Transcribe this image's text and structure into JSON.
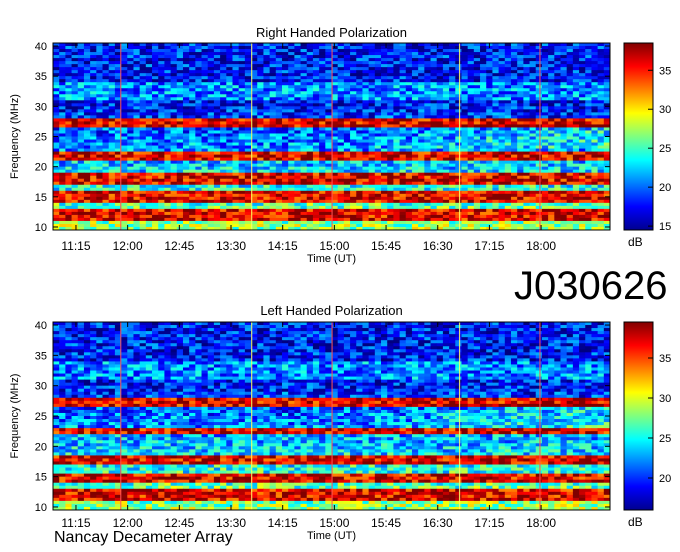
{
  "experiment_id": "J030626",
  "credit": "Nancay Decameter Array",
  "colors": {
    "background": "#ffffff",
    "axis": "#000000"
  },
  "chart_data": [
    {
      "type": "heatmap",
      "title": "Right Handed Polarization",
      "xlabel": "Time (UT)",
      "ylabel": "Frequency (MHz)",
      "xticks": [
        "11:15",
        "12:00",
        "12:45",
        "13:30",
        "14:15",
        "15:00",
        "15:45",
        "16:30",
        "17:15",
        "18:00"
      ],
      "xlim": [
        "10:55",
        "19:00"
      ],
      "yticks": [
        10,
        15,
        20,
        25,
        30,
        35,
        40
      ],
      "ylim": [
        9.5,
        40.5
      ],
      "colorbar": {
        "label": "dB",
        "ticks": [
          15,
          20,
          25,
          30,
          35
        ],
        "range": [
          14.5,
          38.5
        ],
        "colormap": "jet"
      },
      "intense_bands_mhz": [
        [
          11,
          13
        ],
        [
          14,
          16
        ],
        [
          17,
          19
        ],
        [
          21,
          22.5
        ],
        [
          26.5,
          28
        ]
      ],
      "vertical_markers_ut": [
        "11:54",
        "13:48",
        "14:58",
        "16:49",
        "17:59"
      ]
    },
    {
      "type": "heatmap",
      "title": "Left Handed Polarization",
      "xlabel": "Time (UT)",
      "ylabel": "Frequency (MHz)",
      "xticks": [
        "11:15",
        "12:00",
        "12:45",
        "13:30",
        "14:15",
        "15:00",
        "15:45",
        "16:30",
        "17:15",
        "18:00"
      ],
      "xlim": [
        "10:55",
        "19:00"
      ],
      "yticks": [
        10,
        15,
        20,
        25,
        30,
        35,
        40
      ],
      "ylim": [
        9.5,
        40.5
      ],
      "colorbar": {
        "label": "dB",
        "ticks": [
          20,
          25,
          30,
          35
        ],
        "range": [
          16,
          39.5
        ],
        "colormap": "jet"
      },
      "intense_bands_mhz": [
        [
          11,
          13
        ],
        [
          14,
          15.5
        ],
        [
          17,
          18.5
        ],
        [
          22,
          23
        ],
        [
          26.5,
          28
        ]
      ],
      "vertical_markers_ut": [
        "11:54",
        "13:48",
        "14:58",
        "16:49",
        "17:59"
      ]
    }
  ]
}
